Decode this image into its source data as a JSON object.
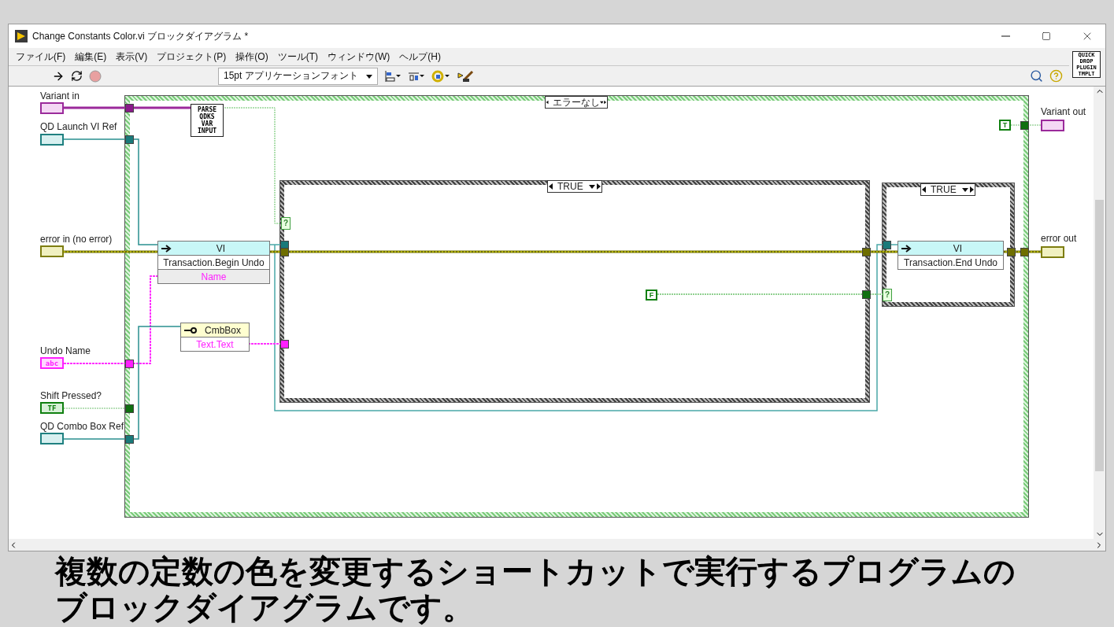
{
  "window": {
    "title": "Change Constants Color.vi ブロックダイアグラム *"
  },
  "menu": [
    "ファイル(F)",
    "編集(E)",
    "表示(V)",
    "プロジェクト(P)",
    "操作(O)",
    "ツール(T)",
    "ウィンドウ(W)",
    "ヘルプ(H)"
  ],
  "toolbar": {
    "font_selector": "15pt アプリケーションフォント",
    "plugin_icon_text": "QUICK DROP PLUGIN TMPLT"
  },
  "diagram": {
    "inputs": [
      {
        "label": "Variant in",
        "kind": "variant"
      },
      {
        "label": "QD Launch VI Ref",
        "kind": "reference"
      },
      {
        "label": "error in (no error)",
        "kind": "error"
      },
      {
        "label": "Undo Name",
        "kind": "string",
        "glyph": "abc"
      },
      {
        "label": "Shift Pressed?",
        "kind": "boolean",
        "glyph": "TF"
      },
      {
        "label": "QD Combo Box Ref",
        "kind": "reference"
      }
    ],
    "outputs": [
      {
        "label": "Variant out",
        "kind": "variant"
      },
      {
        "label": "error out",
        "kind": "error"
      }
    ],
    "case_structures": [
      {
        "kind": "error",
        "selector": "エラーなし"
      },
      {
        "kind": "boolean",
        "selector": "TRUE",
        "selector_glyph": "?"
      },
      {
        "kind": "boolean",
        "selector": "TRUE",
        "selector_glyph": "?"
      }
    ],
    "nodes": [
      {
        "kind": "subvi",
        "text": "PARSE QDKS VAR INPUT"
      },
      {
        "kind": "invoke",
        "class": "VI",
        "method": "Transaction.Begin Undo",
        "param": "Name"
      },
      {
        "kind": "property",
        "class": "CmbBox",
        "property": "Text.Text"
      },
      {
        "kind": "invoke",
        "class": "VI",
        "method": "Transaction.End Undo"
      }
    ],
    "constants": [
      {
        "value": "T"
      },
      {
        "value": "F"
      }
    ]
  },
  "caption": [
    "複数の定数の色を変更するショートカットで実行するプログラムの",
    "ブロックダイアグラムです。"
  ]
}
